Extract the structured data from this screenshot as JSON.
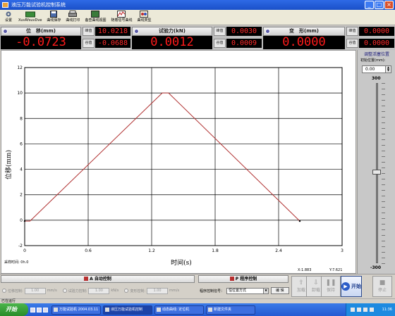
{
  "window": {
    "title": "液压万能试验机控制系统"
  },
  "toolbar": {
    "items": [
      {
        "label": "设置",
        "icon": "gear-icon"
      },
      {
        "label": "XuvRfsuvDve",
        "icon": "device-icon"
      },
      {
        "label": "曲线保存",
        "icon": "save-curve-icon"
      },
      {
        "label": "曲线打印",
        "icon": "printer-icon"
      },
      {
        "label": "备查曲线视图",
        "icon": "curve-view-icon"
      },
      {
        "label": "随着信号曲线",
        "icon": "signal-curve-icon"
      },
      {
        "label": "曲线类型",
        "icon": "curve-type-icon"
      }
    ]
  },
  "panels": [
    {
      "title": "位　移(mm)",
      "value": "-0.0723",
      "peak_label": "峰值",
      "peak_value": "10.0218",
      "valley_label": "谷值",
      "valley_value": "-0.0688"
    },
    {
      "title": "试验力(kN)",
      "value": "0.0012",
      "peak_label": "峰值",
      "peak_value": "0.0030",
      "valley_label": "谷值",
      "valley_value": "0.0009"
    },
    {
      "title": "变　形(mm)",
      "value": "0.0000",
      "peak_label": "峰值",
      "peak_value": "0.0000",
      "valley_label": "谷值",
      "valley_value": "0.0000"
    }
  ],
  "right_panel": {
    "title": "调整活塞位置",
    "label": "初始位置(mm):",
    "spin_value": "0.00",
    "max": "300",
    "min": "-300"
  },
  "chart_data": {
    "type": "line",
    "xlabel": "时间(s)",
    "ylabel": "位移(mm)",
    "xlim": [
      0,
      3
    ],
    "ylim": [
      -2,
      12
    ],
    "x_ticks": [
      "0",
      "0.6",
      "1.2",
      "1.8",
      "2.4",
      "3"
    ],
    "y_ticks": [
      "-2",
      "0",
      "2",
      "4",
      "6",
      "8",
      "10",
      "12"
    ],
    "grid": true,
    "series": [
      {
        "x": [
          0.0,
          0.05,
          1.3,
          1.36,
          2.6
        ],
        "y": [
          -0.07,
          -0.07,
          10.0,
          10.0,
          -0.07
        ],
        "color": "#b03030"
      }
    ],
    "footer_left": "采样时间: 0h.0",
    "footer_x_value": "X:1.883",
    "footer_y_value": "Y:7.621"
  },
  "controls": {
    "auto_label": "A 自动控制",
    "program_label": "P 程序控制",
    "rate_labels": [
      "位移控制:",
      "试验力控制:",
      "变形控制:"
    ],
    "rate_values": [
      "1.00",
      "1.00",
      "1.00"
    ],
    "rate_units": [
      "mm/s",
      "kN/s",
      "mm/s"
    ],
    "program_select_label": "程序控制信号：",
    "program_value": "恒位置方式",
    "edit_label": "编 辑",
    "load_label": "加载",
    "unload_label": "卸载",
    "hold_label": "保持",
    "start_label": "开始",
    "stop_label": "停止"
  },
  "statusbar": {
    "text": "已在运行"
  },
  "taskbar": {
    "start_label": "开始",
    "tasks": [
      "万能试验机 2004.03.11",
      "液压万能试验机控制",
      "动态曲线: 定位机",
      "新建文件夹"
    ],
    "clock": "11:36"
  },
  "colors": {
    "accent": "#1a50c8",
    "digit": "#ff1a1a",
    "curve": "#b03030"
  }
}
